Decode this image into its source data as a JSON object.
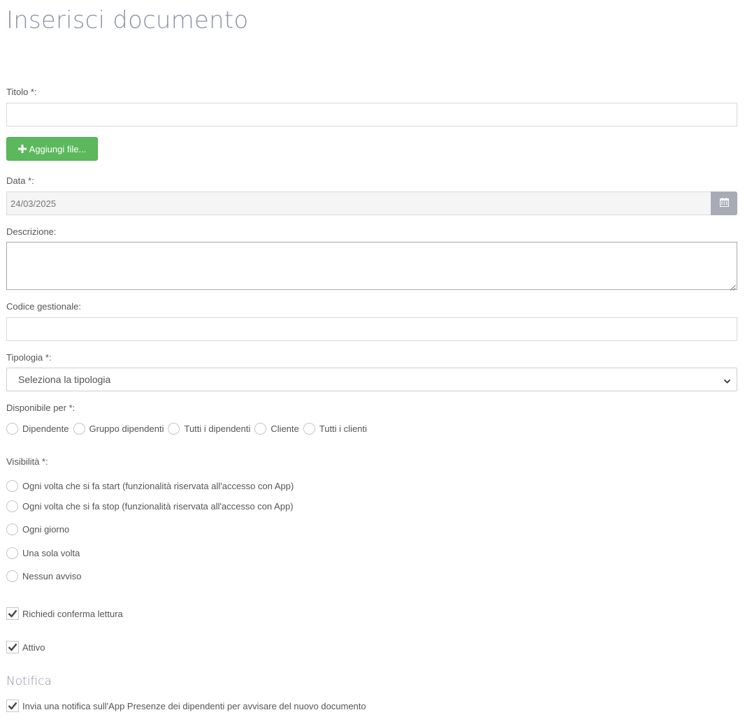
{
  "page": {
    "title": "Inserisci documento"
  },
  "form": {
    "titolo": {
      "label": "Titolo *:",
      "value": ""
    },
    "add_file_label": "Aggiungi file...",
    "data": {
      "label": "Data *:",
      "value": "24/03/2025"
    },
    "descrizione": {
      "label": "Descrizione:",
      "value": ""
    },
    "codice_gestionale": {
      "label": "Codice gestionale:",
      "value": ""
    },
    "tipologia": {
      "label": "Tipologia *:",
      "selected": "Seleziona la tipologia"
    },
    "disponibile_per": {
      "label": "Disponibile per *:",
      "options": [
        "Dipendente",
        "Gruppo dipendenti",
        "Tutti i dipendenti",
        "Cliente",
        "Tutti i clienti"
      ]
    },
    "visibilita": {
      "label": "Visibilità *:",
      "options": [
        "Ogni volta che si fa start (funzionalità riservata all'accesso con App)",
        "Ogni volta che si fa stop (funzionalità riservata all'accesso con App)",
        "Ogni giorno",
        "Una sola volta",
        "Nessun avviso"
      ]
    },
    "richiedi_conferma": {
      "label": "Richiedi conferma lettura",
      "checked": true
    },
    "attivo": {
      "label": "Attivo",
      "checked": true
    }
  },
  "notifica": {
    "heading": "Notifica",
    "invia": {
      "label": "Invia una notifica sull'App Presenze dei dipendenti per avvisare del nuovo documento",
      "checked": true
    }
  },
  "icons": {
    "add": "plus-icon",
    "calendar": "calendar-icon",
    "select": "chevron-down-icon",
    "check": "checkmark-icon"
  },
  "colors": {
    "primary_green": "#5cb85c",
    "title_gray": "#8d93a8",
    "calendar_button": "#a8abb6"
  }
}
